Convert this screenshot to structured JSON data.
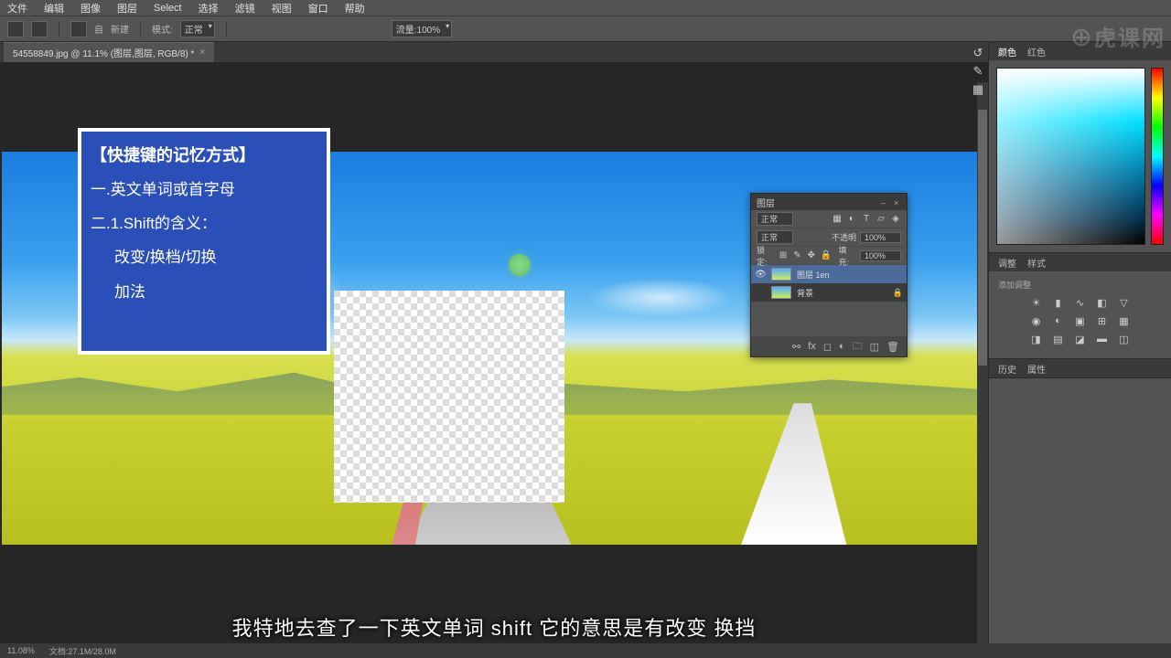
{
  "menu": {
    "items": [
      "文件",
      "编辑",
      "图像",
      "图层",
      "Select",
      "选择",
      "滤镜",
      "视图",
      "窗口",
      "帮助"
    ]
  },
  "optbar": {
    "label1": "自",
    "label2": "新建",
    "mode": "正常",
    "flow": "100%",
    "opt2": "流量:100%"
  },
  "tab": {
    "name": "54558849.jpg @ 11.1% (图层,图层, RGB/8) *",
    "close": "×"
  },
  "instruct": {
    "title": "【快捷键的记忆方式】",
    "l1": "一.英文单词或首字母",
    "l2": "二.1.Shift的含义：",
    "l3": "改变/换档/切换",
    "l4": "加法"
  },
  "layers": {
    "title": "图层",
    "mode_label": "正常",
    "opacity_label": "不透明",
    "opacity_val": "100%",
    "lock_label": "锁定:",
    "fill_label": "填充:",
    "fill_val": "100%",
    "row1": "图层 1en",
    "row2": "背景"
  },
  "rp": {
    "tab_color": "颜色",
    "tab_swatch": "红色",
    "tab_adj": "调整",
    "tab_style": "样式",
    "normal": "添加调整",
    "tab_hist": "历史",
    "tab_prop": "属性"
  },
  "subtitle": "我特地去查了一下英文单词  shift  它的意思是有改变  换挡",
  "status": {
    "zoom": "11.08%",
    "info": "文档:27.1M/28.0M"
  },
  "watermark": "⊕虎课网"
}
